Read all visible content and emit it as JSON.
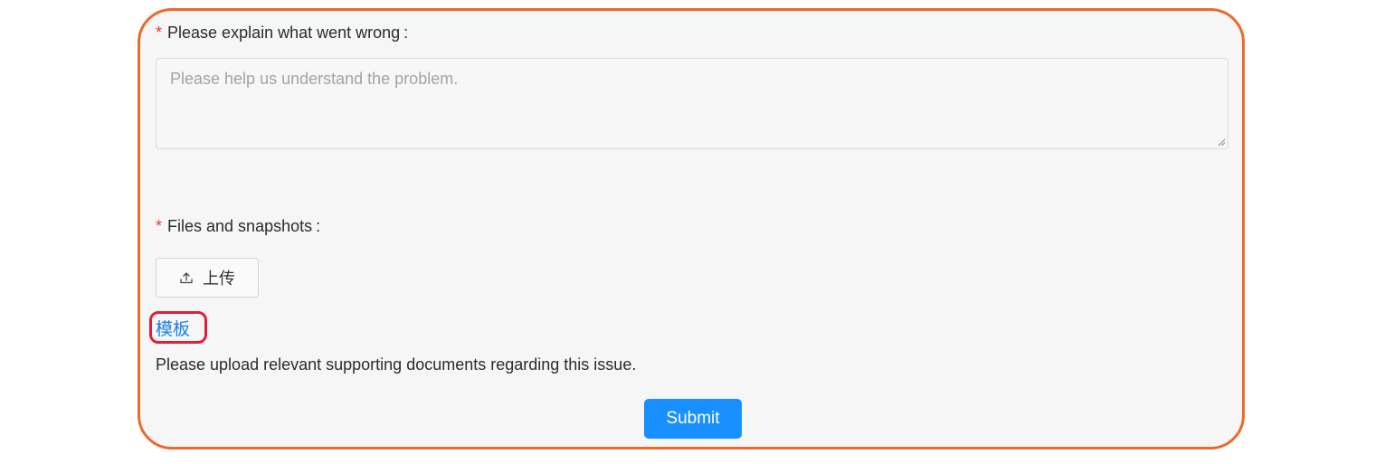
{
  "form": {
    "problem_field": {
      "required_mark": "*",
      "label": "Please explain what went wrong",
      "colon": ":",
      "value": "",
      "placeholder": "Please help us understand the problem."
    },
    "files_field": {
      "required_mark": "*",
      "label": "Files and snapshots",
      "colon": ":",
      "upload_icon": "upload-icon",
      "upload_label": "上传",
      "template_link": "模板",
      "hint": "Please upload relevant supporting documents regarding this issue."
    },
    "submit_label": "Submit"
  },
  "colors": {
    "frame_border": "#ec6a2a",
    "required_mark": "#e03a3a",
    "link": "#1a7fe3",
    "highlight_border": "#e0203a",
    "primary_button": "#1890ff"
  }
}
